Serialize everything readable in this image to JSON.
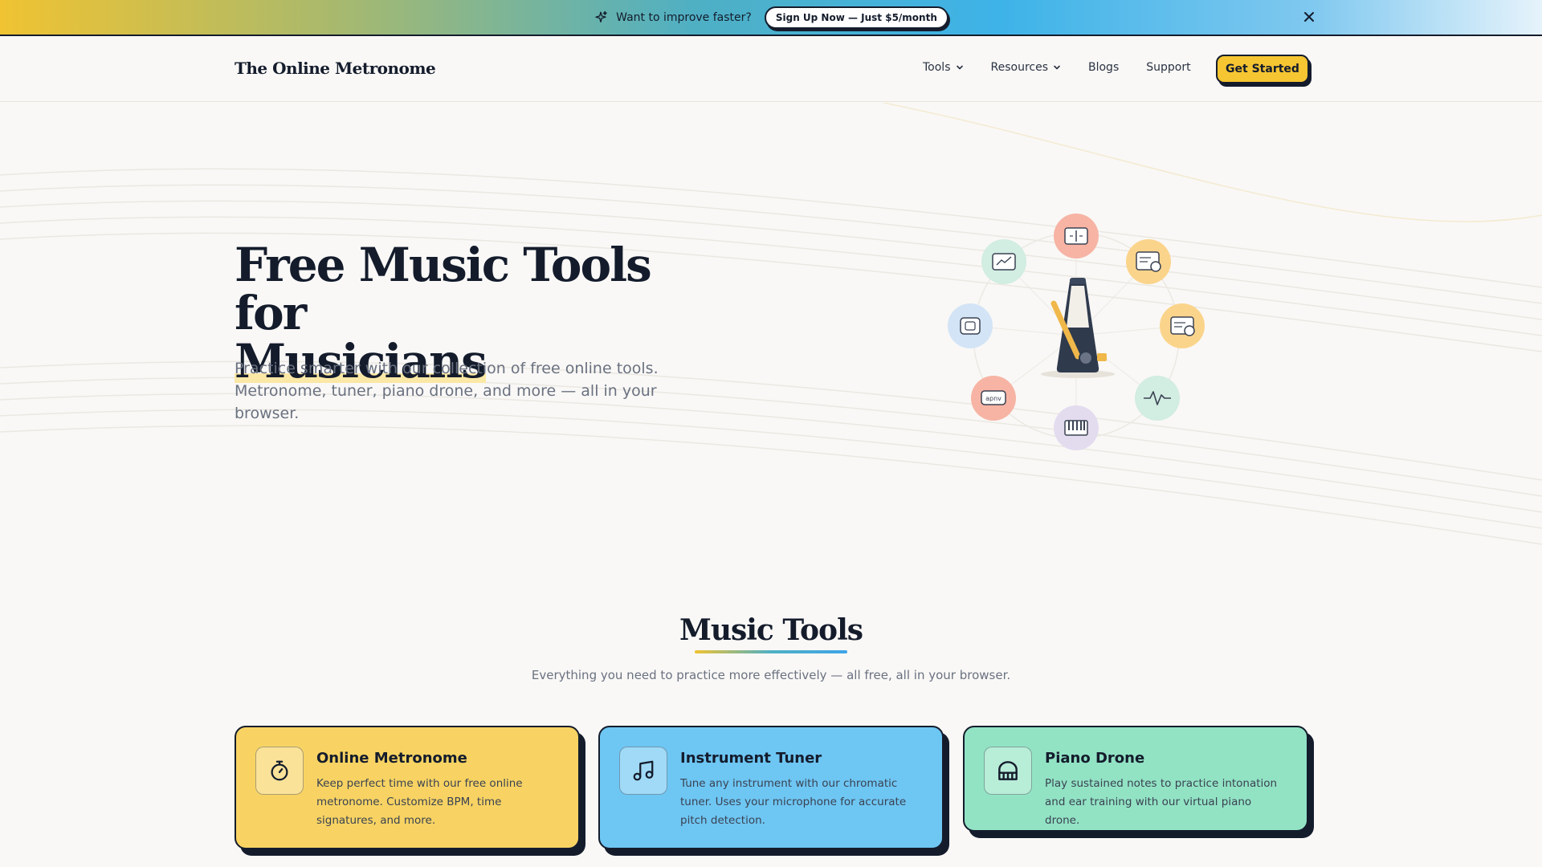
{
  "announcement": {
    "message": "Want to improve faster?",
    "cta": "Sign Up Now — Just $5/month"
  },
  "nav": {
    "logo": "The Online Metronome",
    "links": [
      "Tools",
      "Resources",
      "Blogs",
      "Support"
    ],
    "cta": "Get Started"
  },
  "hero": {
    "title_line1": "Free Music Tools for",
    "title_line2": "Musicians",
    "subtitle": "Practice smarter with our collection of free online tools. Metronome, tuner, piano drone, and more — all in your browser.",
    "orbit_badge": "apnv"
  },
  "section": {
    "title": "Music Tools",
    "subtitle": "Everything you need to practice more effectively — all free, all in your browser."
  },
  "cards": [
    {
      "title": "Online Metronome",
      "desc": "Keep perfect time with our free online metronome. Customize BPM, time signatures, and more.",
      "icon": "stopwatch-icon",
      "color": "#f8d363"
    },
    {
      "title": "Instrument Tuner",
      "desc": "Tune any instrument with our chromatic tuner. Uses your microphone for accurate pitch detection.",
      "icon": "music-note-icon",
      "color": "#6ec6f3"
    },
    {
      "title": "Piano Drone",
      "desc": "Play sustained notes to practice intonation and ear training with our virtual piano drone.",
      "icon": "piano-icon",
      "color": "#92e3c4"
    }
  ]
}
